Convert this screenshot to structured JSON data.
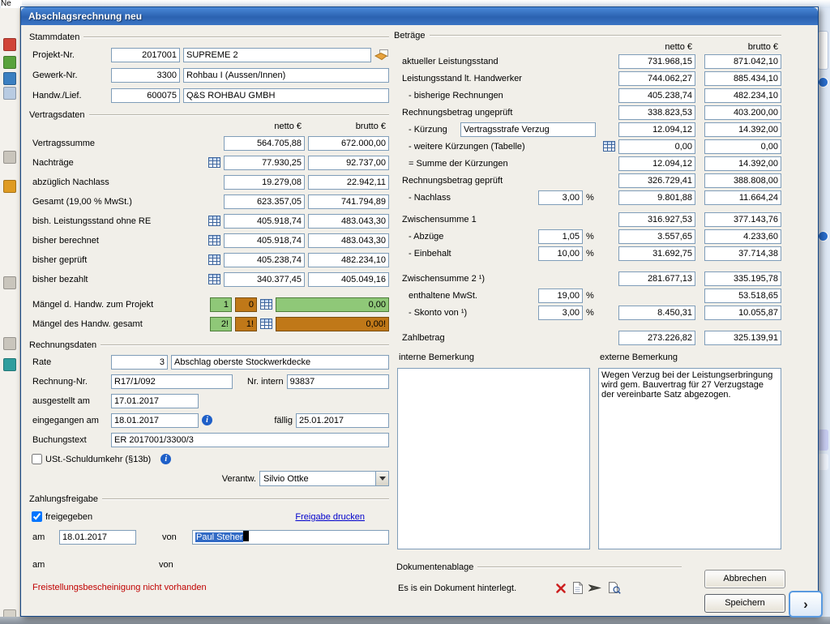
{
  "window": {
    "title": "Abschlagsrechnung neu"
  },
  "background": {
    "fragment_text": "Ne",
    "nav_arrow": "›"
  },
  "icons": {
    "info_glyph": "i"
  },
  "colors": {
    "maengel_green": "#8fc878",
    "maengel_orange": "#c07818",
    "warning_red": "#c00000",
    "link_blue": "#0000cc",
    "selection_blue": "#316ac5"
  },
  "stammdaten": {
    "title": "Stammdaten",
    "rows": [
      {
        "label": "Projekt-Nr.",
        "nr": "2017001",
        "name": "SUPREME 2"
      },
      {
        "label": "Gewerk-Nr.",
        "nr": "3300",
        "name": "Rohbau I (Aussen/Innen)"
      },
      {
        "label": "Handw./Lief.",
        "nr": "600075",
        "name": "Q&S ROHBAU GMBH"
      }
    ]
  },
  "vertragsdaten": {
    "title": "Vertragsdaten",
    "header_netto": "netto €",
    "header_brutto": "brutto €",
    "rows": [
      {
        "label": "Vertragssumme",
        "netto": "564.705,88",
        "brutto": "672.000,00"
      },
      {
        "label": "Nachträge",
        "netto": "77.930,25",
        "brutto": "92.737,00"
      },
      {
        "label": "abzüglich Nachlass",
        "netto": "19.279,08",
        "brutto": "22.942,11"
      },
      {
        "label": "Gesamt (19,00 % MwSt.)",
        "netto": "623.357,05",
        "brutto": "741.794,89"
      },
      {
        "label": "bish. Leistungsstand ohne RE",
        "netto": "405.918,74",
        "brutto": "483.043,30"
      },
      {
        "label": "bisher berechnet",
        "netto": "405.918,74",
        "brutto": "483.043,30"
      },
      {
        "label": "bisher geprüft",
        "netto": "405.238,74",
        "brutto": "482.234,10"
      },
      {
        "label": "bisher bezahlt",
        "netto": "340.377,45",
        "brutto": "405.049,16"
      }
    ],
    "maengel": [
      {
        "label": "Mängel d. Handw. zum Projekt",
        "green": "1",
        "orange": "0",
        "amount": "0,00"
      },
      {
        "label": "Mängel des Handw. gesamt",
        "green": "2!",
        "orange": "1!",
        "amount": "0,00!"
      }
    ]
  },
  "rechnungsdaten": {
    "title": "Rechnungsdaten",
    "rate_label": "Rate",
    "rate_value": "3",
    "rate_text": "Abschlag oberste Stockwerkdecke",
    "rechnung_nr_label": "Rechnung-Nr.",
    "rechnung_nr": "R17/1/092",
    "nr_intern_label": "Nr. intern",
    "nr_intern": "93837",
    "ausgestellt_label": "ausgestellt am",
    "ausgestellt_am": "17.01.2017",
    "eingegangen_label": "eingegangen am",
    "eingegangen_am": "18.01.2017",
    "faellig_label": "fällig",
    "faellig_am": "25.01.2017",
    "buchungstext_label": "Buchungstext",
    "buchungstext": "ER 2017001/3300/3",
    "ust_label": "USt.-Schuldumkehr (§13b)",
    "verantw_label": "Verantw.",
    "verantw_value": "Silvio Ottke"
  },
  "zahlungsfreigabe": {
    "title": "Zahlungsfreigabe",
    "freigegeben_label": "freigegeben",
    "freigabe_link": "Freigabe drucken",
    "am_label": "am",
    "am_value": "18.01.2017",
    "von_label": "von",
    "von_value": "Paul Steher",
    "am2_label": "am",
    "von2_label": "von",
    "warning": "Freistellungsbescheinigung nicht vorhanden"
  },
  "betraege": {
    "title": "Beträge",
    "header_netto": "netto €",
    "header_brutto": "brutto €",
    "percent": "%",
    "aktueller": {
      "label": "aktueller Leistungsstand",
      "netto": "731.968,15",
      "brutto": "871.042,10"
    },
    "lt_handwerker": {
      "label": "Leistungsstand lt. Handwerker",
      "netto": "744.062,27",
      "brutto": "885.434,10"
    },
    "bisherige": {
      "label": "- bisherige Rechnungen",
      "netto": "405.238,74",
      "brutto": "482.234,10"
    },
    "ungeprueft": {
      "label": "Rechnungsbetrag ungeprüft",
      "netto": "338.823,53",
      "brutto": "403.200,00"
    },
    "kuerzung": {
      "label": "- Kürzung",
      "text": "Vertragsstrafe Verzug",
      "netto": "12.094,12",
      "brutto": "14.392,00"
    },
    "weitere": {
      "label": "- weitere Kürzungen (Tabelle)",
      "netto": "0,00",
      "brutto": "0,00"
    },
    "summe_kuerzungen": {
      "label": "= Summe der Kürzungen",
      "netto": "12.094,12",
      "brutto": "14.392,00"
    },
    "geprueft": {
      "label": "Rechnungsbetrag geprüft",
      "netto": "326.729,41",
      "brutto": "388.808,00"
    },
    "nachlass": {
      "label": "- Nachlass",
      "pct": "3,00",
      "netto": "9.801,88",
      "brutto": "11.664,24"
    },
    "zwischensumme1": {
      "label": "Zwischensumme 1",
      "netto": "316.927,53",
      "brutto": "377.143,76"
    },
    "abzuege": {
      "label": "- Abzüge",
      "pct": "1,05",
      "netto": "3.557,65",
      "brutto": "4.233,60"
    },
    "einbehalt": {
      "label": "- Einbehalt",
      "pct": "10,00",
      "netto": "31.692,75",
      "brutto": "37.714,38"
    },
    "zwischensumme2": {
      "label": "Zwischensumme 2 ¹)",
      "netto": "281.677,13",
      "brutto": "335.195,78"
    },
    "mwst": {
      "label": "enthaltene MwSt.",
      "pct": "19,00",
      "brutto": "53.518,65"
    },
    "skonto": {
      "label": "- Skonto von ¹)",
      "pct": "3,00",
      "netto": "8.450,31",
      "brutto": "10.055,87"
    },
    "zahlbetrag": {
      "label": "Zahlbetrag",
      "netto": "273.226,82",
      "brutto": "325.139,91"
    }
  },
  "bemerkungen": {
    "interne_label": "interne Bemerkung",
    "externe_label": "externe Bemerkung",
    "interne_text": "",
    "externe_text": "Wegen Verzug bei der Leistungserbringung wird gem. Bauvertrag für 27 Verzugstage der vereinbarte Satz abgezogen."
  },
  "dokumente": {
    "title": "Dokumentenablage",
    "text": "Es is ein Dokument hinterlegt."
  },
  "buttons": {
    "abbrechen": "Abbrechen",
    "speichern": "Speichern"
  }
}
